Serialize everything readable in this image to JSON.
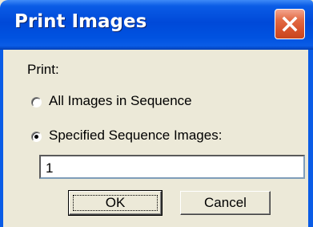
{
  "window": {
    "title": "Print Images",
    "close_icon": "close-x-icon"
  },
  "form": {
    "print_label": "Print:",
    "options": [
      {
        "label": "All Images in Sequence",
        "selected": false
      },
      {
        "label": "Specified Sequence Images:",
        "selected": true
      }
    ],
    "sequence_value": "1"
  },
  "buttons": {
    "ok_label": "OK",
    "cancel_label": "Cancel"
  },
  "colors": {
    "titlebar": "#0a5ce6",
    "close_button": "#e36b45",
    "dialog_face": "#ece9d8"
  }
}
